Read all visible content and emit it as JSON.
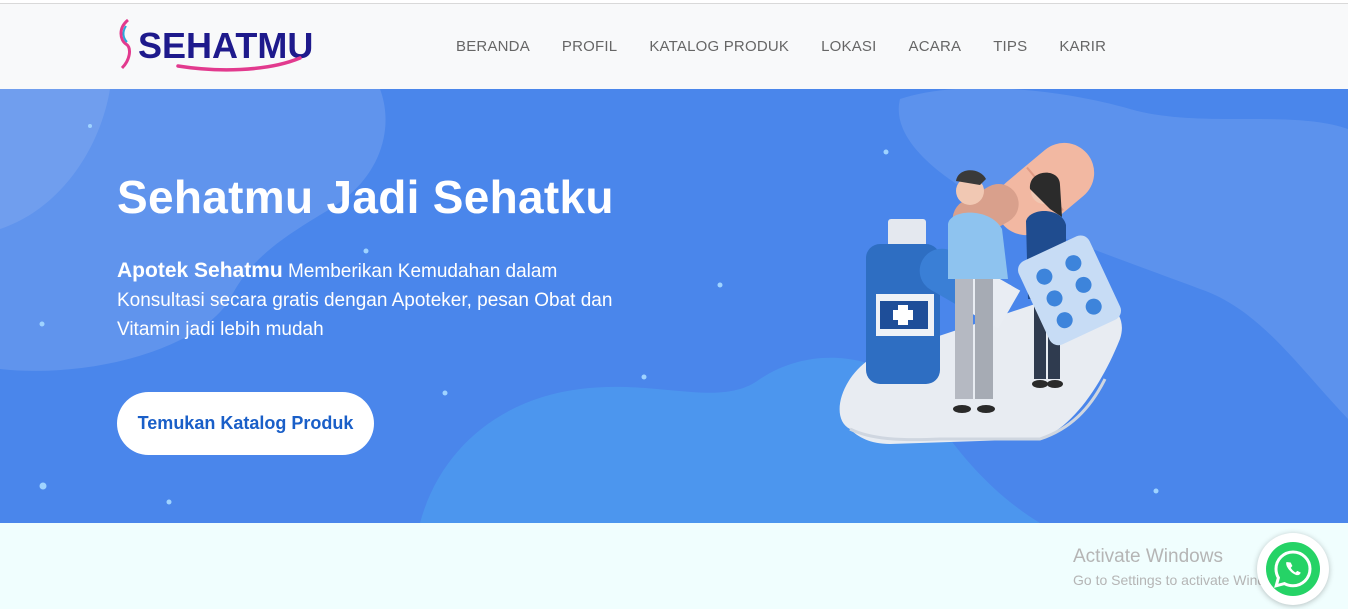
{
  "brand": {
    "name": "SEHATMU"
  },
  "nav": {
    "items": [
      {
        "label": "BERANDA"
      },
      {
        "label": "PROFIL"
      },
      {
        "label": "KATALOG PRODUK"
      },
      {
        "label": "LOKASI"
      },
      {
        "label": "ACARA"
      },
      {
        "label": "TIPS"
      },
      {
        "label": "KARIR"
      }
    ]
  },
  "hero": {
    "title": "Sehatmu Jadi Sehatku",
    "desc_bold": "Apotek Sehatmu",
    "desc_rest": " Memberikan Kemudahan dalam Konsultasi secara gratis dengan Apoteker, pesan Obat dan Vitamin jadi lebih mudah",
    "button_label": "Temukan Katalog Produk"
  },
  "watermark": {
    "line1": "Activate Windows",
    "line2": "Go to Settings to activate Windows."
  },
  "icons": {
    "whatsapp": "whatsapp-icon",
    "logo": "sehatmu-logo-mark"
  },
  "colors": {
    "hero_bg": "#4a86eb",
    "brand_navy": "#1e1a8c",
    "brand_pink": "#e23a8e",
    "whatsapp_green": "#25d366"
  }
}
